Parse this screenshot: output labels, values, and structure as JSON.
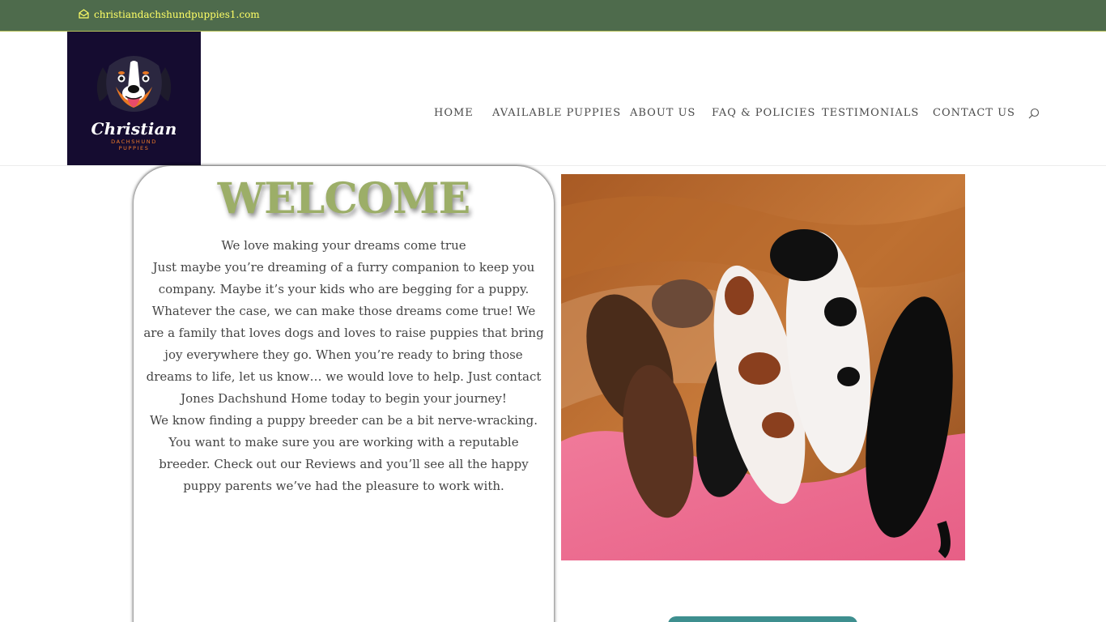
{
  "topbar": {
    "email": "christiandachshundpuppies1.com",
    "icon": "envelope-icon",
    "background": "#4e6b4c",
    "text_color": "#ffff66"
  },
  "logo": {
    "brand": "Christian",
    "line1": "DACHSHUND",
    "line2": "PUPPIES",
    "background": "#150c30",
    "icon": "dog-face-logo-icon"
  },
  "nav": {
    "items": [
      {
        "label": "HOME"
      },
      {
        "label": "AVAILABLE PUPPIES"
      },
      {
        "label": "ABOUT US"
      },
      {
        "label": "FAQ & POLICIES"
      },
      {
        "label": "TESTIMONIALS"
      },
      {
        "label": "CONTACT US"
      }
    ],
    "search_icon": "search-icon"
  },
  "welcome": {
    "title": "WELCOME",
    "title_color": "#9cae68",
    "paragraphs": [
      "We love making your dreams come true",
      "Just maybe you’re dreaming of a furry companion to keep you company. Maybe it’s your kids who are begging for a puppy. Whatever the case, we can make those dreams come true! We are a family that loves dogs and loves to raise puppies that bring joy everywhere they go. When you’re ready to bring those dreams to life, let us know… we would love to help. Just contact Jones Dachshund Home today to begin your journey!",
      "We know finding a puppy breeder can be a bit nerve-wracking. You want to make sure you are working with a reputable breeder. Check out our Reviews and you’ll see all the happy puppy parents we’ve had the pleasure to work with."
    ]
  },
  "photo": {
    "subject": "nursing-puppies-photo"
  },
  "cta": {
    "color": "#3e8f8f"
  }
}
